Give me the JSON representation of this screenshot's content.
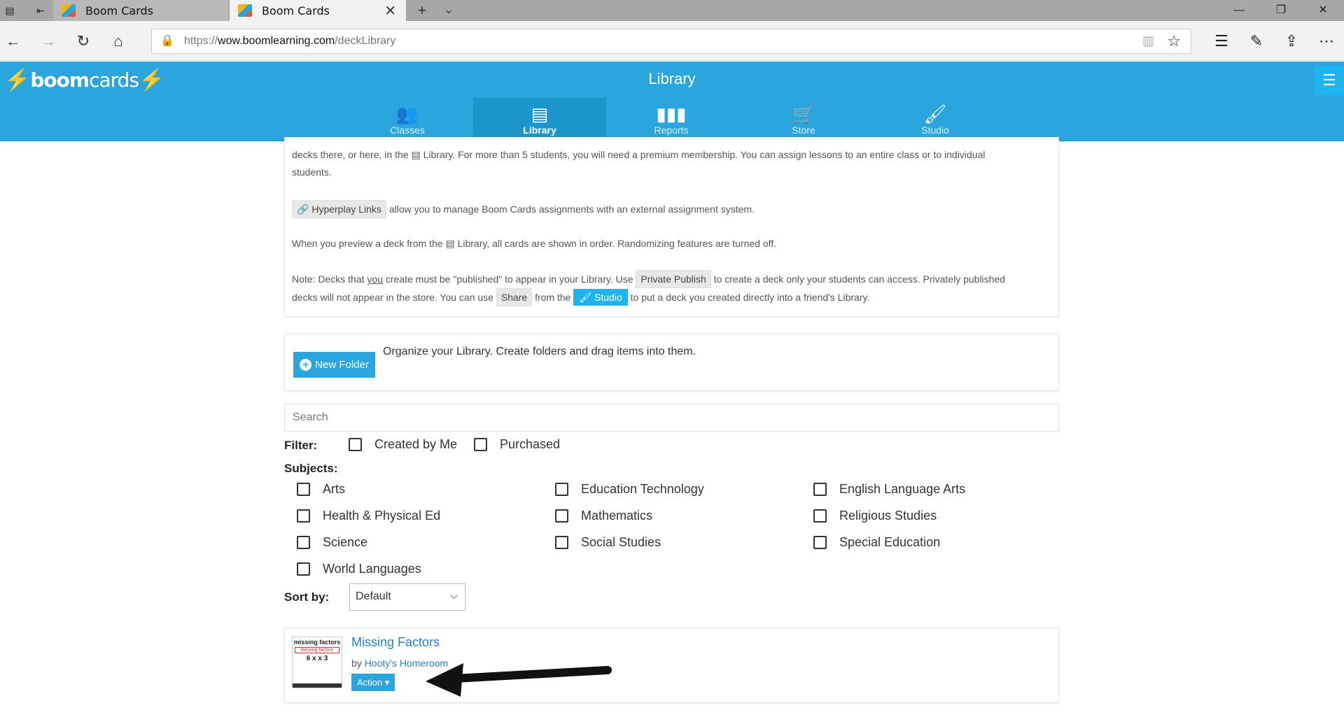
{
  "browser": {
    "tabs": [
      {
        "title": "Boom Cards",
        "active": false
      },
      {
        "title": "Boom Cards",
        "active": true
      }
    ],
    "url_prefix": "https://",
    "url_domain": "wow.boomlearning.com",
    "url_path": "/deckLibrary"
  },
  "app": {
    "logo_boom": "boom",
    "logo_cards": "cards",
    "title": "Library",
    "nav": [
      {
        "label": "Classes",
        "icon": "classes-icon"
      },
      {
        "label": "Library",
        "icon": "library-icon",
        "active": true
      },
      {
        "label": "Reports",
        "icon": "reports-icon"
      },
      {
        "label": "Store",
        "icon": "cart-icon"
      },
      {
        "label": "Studio",
        "icon": "brush-icon"
      }
    ]
  },
  "info": {
    "line1_a": "decks there, or here, in the",
    "line1_lib": "Library. For more than 5 students, you will need a premium membership. You can assign lessons to an entire class or to individual",
    "line1_b": "students.",
    "hyperplay_chip": "Hyperplay Links",
    "hyperplay_text": "allow you to manage Boom Cards assignments with an external assignment system.",
    "preview_a": "When you preview a deck from the",
    "preview_b": "Library, all cards are shown in order. Randomizing features are turned off.",
    "note_a": "Note: Decks that",
    "note_you": "you",
    "note_b": "create must be \"published\" to appear in your Library. Use",
    "private_publish": "Private Publish",
    "note_c": "to create a deck only your students can access. Privately published",
    "note_d": "decks will not appear in the store. You can use",
    "share": "Share",
    "note_e": "from the",
    "studio": "Studio",
    "note_f": "to put a deck you created directly into a friend's Library."
  },
  "folders": {
    "button": "New Folder",
    "text": "Organize your Library. Create folders and drag items into them."
  },
  "search": {
    "placeholder": "Search"
  },
  "filter": {
    "label": "Filter:",
    "options": [
      "Created by Me",
      "Purchased"
    ]
  },
  "subjects": {
    "label": "Subjects:",
    "items": [
      "Arts",
      "Education Technology",
      "English Language Arts",
      "Health & Physical Ed",
      "Mathematics",
      "Religious Studies",
      "Science",
      "Social Studies",
      "Special Education",
      "World Languages"
    ]
  },
  "sort": {
    "label": "Sort by:",
    "value": "Default"
  },
  "deck": {
    "title": "Missing Factors",
    "by": "by",
    "author": "Hooty's Homeroom",
    "action": "Action",
    "thumb_title": "missing factors",
    "thumb_sub": "missing factors",
    "thumb_math": "6 x    x 3"
  }
}
